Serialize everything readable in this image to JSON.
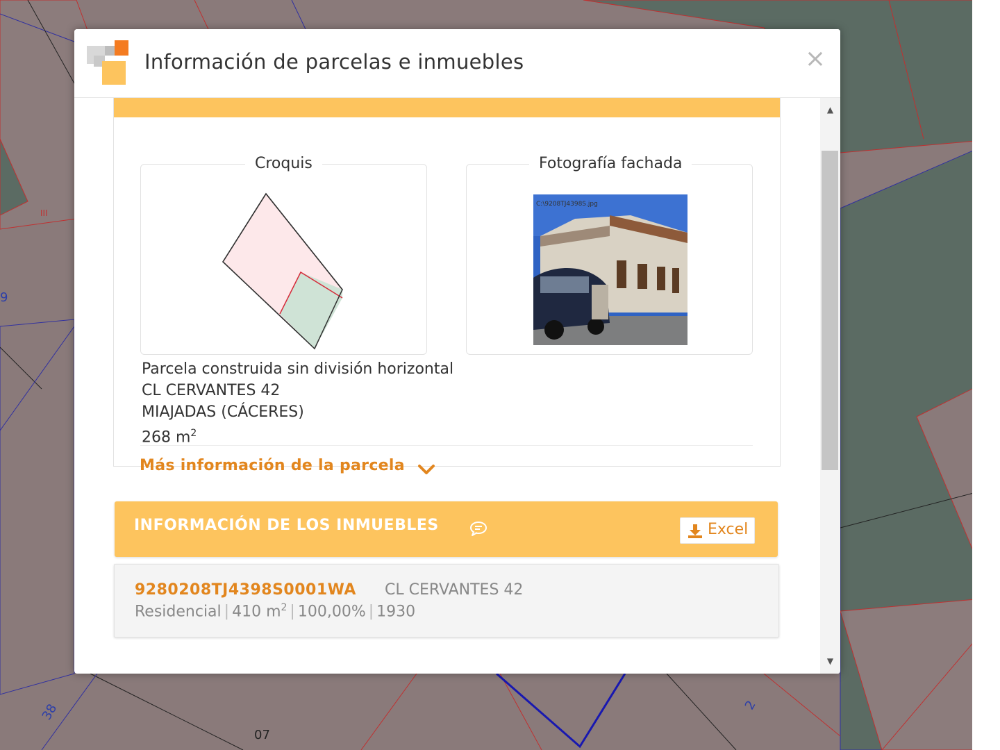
{
  "map": {
    "labels": [
      "38",
      "07",
      "2",
      "III",
      "9"
    ]
  },
  "dialog": {
    "title": "Información de parcelas e inmuebles",
    "close_symbol": "×",
    "close_icon": "close-icon",
    "app_icon": "catastro-logo-icon"
  },
  "parcela": {
    "croquis_label": "Croquis",
    "fachada_label": "Fotografía fachada",
    "photo_caption": "C:\\9208TJ4398S.jpg",
    "type": "Parcela construida sin división horizontal",
    "address": "CL CERVANTES 42",
    "municipality": "MIAJADAS (CÁCERES)",
    "surface_value": "268 m",
    "surface_unit_sup": "2",
    "more_info": "Más información de la parcela",
    "more_info_icon": "chevron-down-icon"
  },
  "inmuebles": {
    "title": "INFORMACIÓN DE LOS INMUEBLES",
    "title_icon": "chat-bubble-icon",
    "excel_label": "Excel",
    "excel_icon": "download-icon",
    "items": [
      {
        "ref": "9280208TJ4398S0001WA",
        "address": "CL CERVANTES 42",
        "use": "Residencial",
        "surface_value": "410 m",
        "surface_unit_sup": "2",
        "participation": "100,00%",
        "year": "1930"
      }
    ]
  },
  "colors": {
    "accent_orange": "#e2861e",
    "panel_yellow": "#fdc45e",
    "map_parcel": "#8a7a7a",
    "map_green": "#5b6b63"
  },
  "scrollbar": {
    "up_arrow": "▲",
    "down_arrow": "▼"
  }
}
